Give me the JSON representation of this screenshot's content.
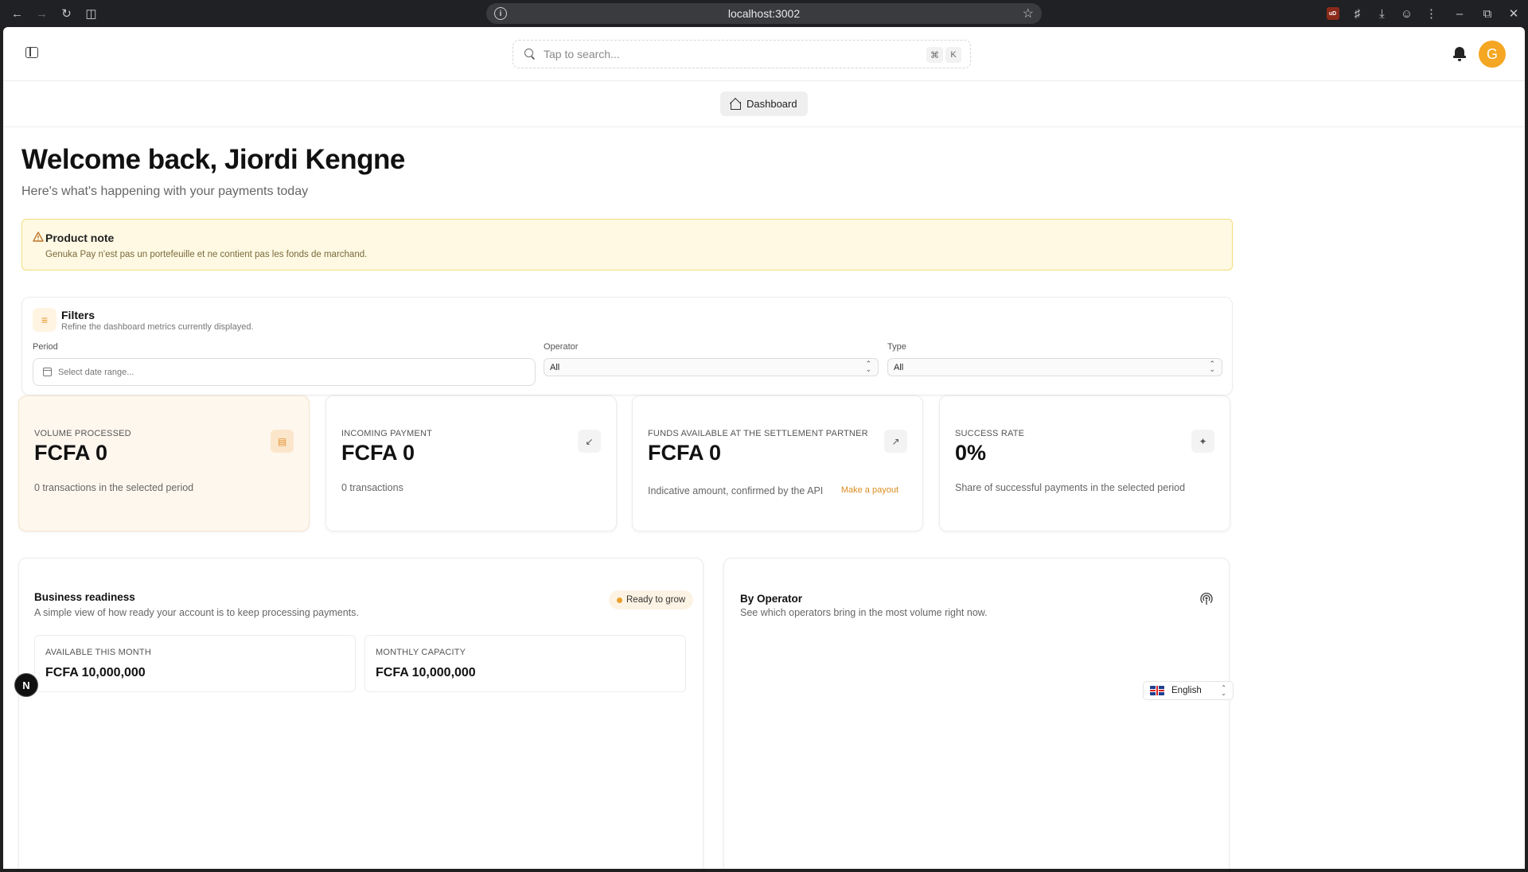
{
  "browser": {
    "url": "localhost:3002",
    "icons": [
      "back-icon",
      "forward-icon",
      "reload-icon",
      "split-view-icon",
      "info-icon",
      "star-icon",
      "ublock-icon",
      "extensions-icon",
      "download-icon",
      "profile-icon",
      "menu-icon",
      "minimize-icon",
      "restore-icon",
      "close-icon"
    ],
    "ublock_label": "uD"
  },
  "topbar": {
    "search_placeholder": "Tap to search...",
    "shortcut_mod": "⌘",
    "shortcut_key": "K",
    "avatar_initial": "G"
  },
  "breadcrumb": {
    "label": "Dashboard"
  },
  "header": {
    "title": "Welcome back, Jiordi Kengne",
    "subtitle": "Here's what's happening with your payments today"
  },
  "note": {
    "title": "Product note",
    "body": "Genuka Pay n'est pas un portefeuille et ne contient pas les fonds de marchand."
  },
  "filters": {
    "title": "Filters",
    "subtitle": "Refine the dashboard metrics currently displayed.",
    "period_label": "Period",
    "period_placeholder": "Select date range...",
    "operator_label": "Operator",
    "operator_value": "All",
    "type_label": "Type",
    "type_value": "All"
  },
  "stats": [
    {
      "label": "VOLUME PROCESSED",
      "value": "FCFA 0",
      "desc": "0 transactions in the selected period",
      "icon": "wallet-icon"
    },
    {
      "label": "INCOMING PAYMENT",
      "value": "FCFA 0",
      "desc": "0 transactions",
      "icon": "arrow-down-left-icon"
    },
    {
      "label": "FUNDS AVAILABLE AT THE SETTLEMENT PARTNER",
      "value": "FCFA 0",
      "desc": "Indicative amount, confirmed by the API",
      "action": "Make a payout",
      "icon": "arrow-up-right-icon"
    },
    {
      "label": "SUCCESS RATE",
      "value": "0%",
      "desc": "Share of successful payments in the selected period",
      "icon": "sparkles-icon"
    }
  ],
  "readiness": {
    "title": "Business readiness",
    "subtitle": "A simple view of how ready your account is to keep processing payments.",
    "badge": "Ready to grow",
    "available_label": "AVAILABLE THIS MONTH",
    "available_value": "FCFA 10,000,000",
    "capacity_label": "MONTHLY CAPACITY",
    "capacity_value": "FCFA 10,000,000"
  },
  "operators": {
    "title": "By Operator",
    "subtitle": "See which operators bring in the most volume right now."
  },
  "dev_badge": "N",
  "language": {
    "value": "English"
  },
  "colors": {
    "accent": "#eca02c",
    "avatar": "#f5a623",
    "note_bg": "#fff9e3",
    "note_border": "#f3dc7a"
  }
}
